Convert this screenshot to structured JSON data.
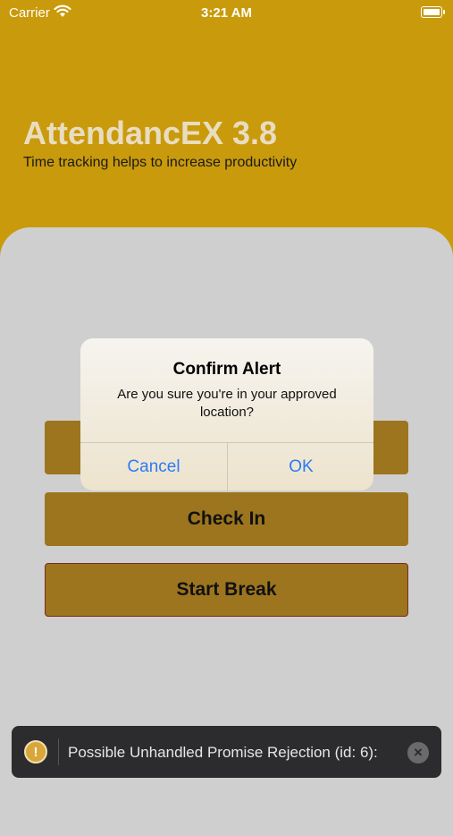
{
  "status_bar": {
    "carrier": "Carrier",
    "time": "3:21 AM",
    "wifi_icon": "wifi-icon",
    "battery_icon": "battery-icon"
  },
  "header": {
    "title": "AttendancEX 3.8",
    "subtitle": "Time tracking helps to increase productivity"
  },
  "actions": {
    "check_in_label": "Check In",
    "start_break_label": "Start Break"
  },
  "alert": {
    "title": "Confirm Alert",
    "message": "Are you sure you're in your approved location?",
    "cancel_label": "Cancel",
    "ok_label": "OK"
  },
  "toast": {
    "icon": "warning-icon",
    "message": "Possible Unhandled Promise Rejection (id: 6):",
    "close_icon": "close-icon",
    "icon_glyph": "!",
    "close_glyph": "×"
  },
  "colors": {
    "header_bg": "#c99a0b",
    "panel_bg": "#cfcfcf",
    "button_bg": "#9c751e",
    "link_blue": "#2a7bf6",
    "toast_bg": "#2c2c2e"
  }
}
